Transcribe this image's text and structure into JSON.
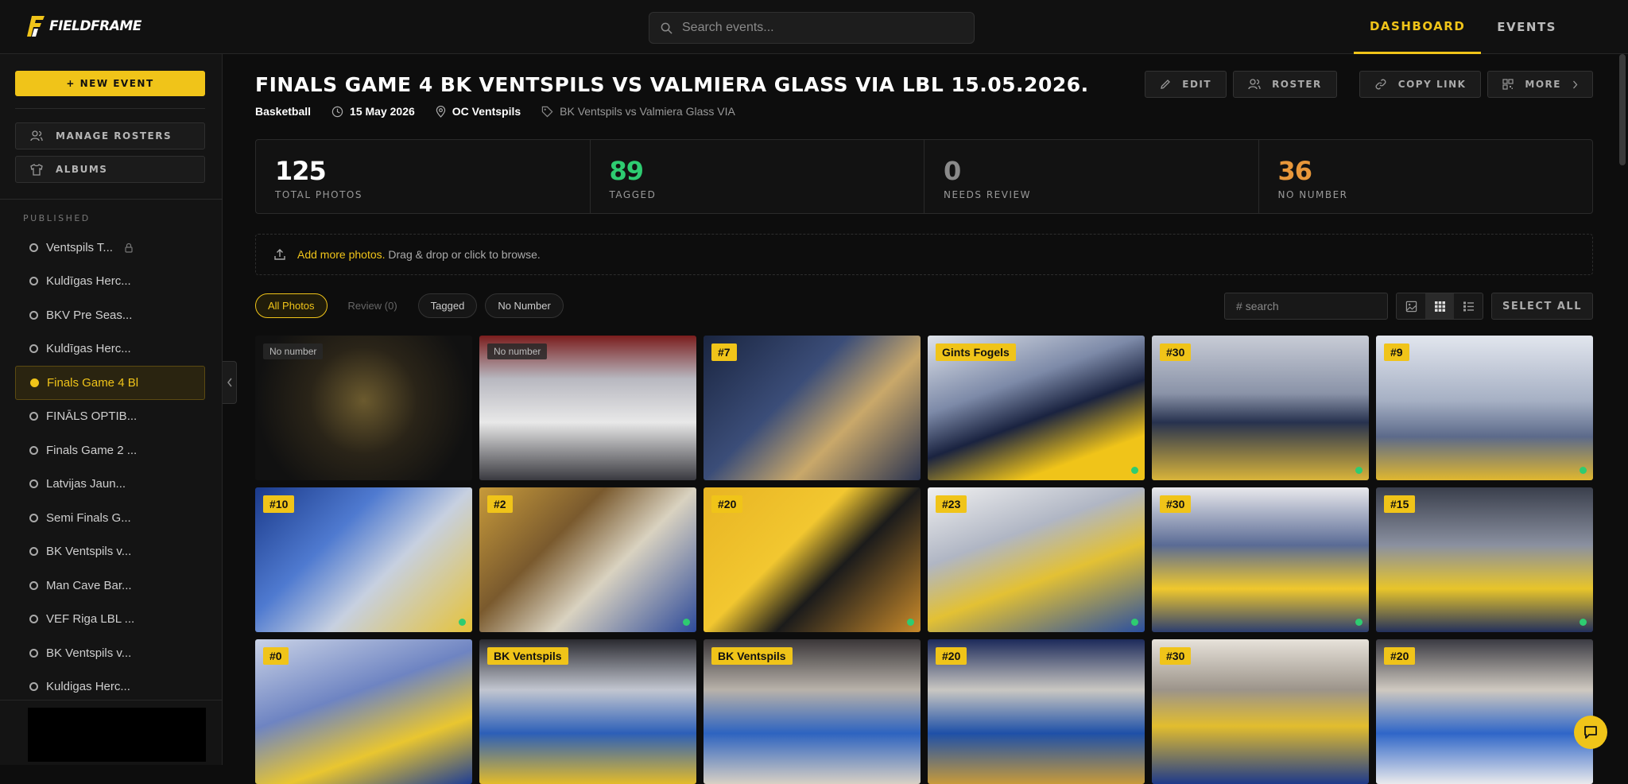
{
  "app": {
    "brand": "FIELDFRAME"
  },
  "topbar": {
    "search_placeholder": "Search events...",
    "nav": [
      {
        "label": "DASHBOARD",
        "active": true
      },
      {
        "label": "EVENTS",
        "active": false
      }
    ]
  },
  "sidebar": {
    "new_event_label": "+ NEW EVENT",
    "manage_rosters_label": "MANAGE ROSTERS",
    "albums_label": "ALBUMS",
    "section_label": "PUBLISHED",
    "events": [
      {
        "label": "Ventspils T...",
        "locked": true,
        "active": false
      },
      {
        "label": "Kuldīgas Herc...",
        "active": false
      },
      {
        "label": "BKV Pre Seas...",
        "active": false
      },
      {
        "label": "Kuldīgas Herc...",
        "active": false
      },
      {
        "label": "Finals Game 4 Bl",
        "active": true
      },
      {
        "label": "FINĀLS OPTIB...",
        "active": false
      },
      {
        "label": "Finals Game 2 ...",
        "active": false
      },
      {
        "label": "Latvijas Jaun...",
        "active": false
      },
      {
        "label": "Semi Finals G...",
        "active": false
      },
      {
        "label": "BK Ventspils v...",
        "active": false
      },
      {
        "label": "Man Cave Bar...",
        "active": false
      },
      {
        "label": "VEF Riga LBL ...",
        "active": false
      },
      {
        "label": "BK Ventspils v...",
        "active": false
      },
      {
        "label": "Kuldigas Herc...",
        "active": false
      }
    ]
  },
  "event": {
    "title": "FINALS GAME 4 BK VENTSPILS VS VALMIERA GLASS VIA LBL 15.05.2026.",
    "sport": "Basketball",
    "date": "15 May 2026",
    "venue": "OC Ventspils",
    "tag": "BK Ventspils vs Valmiera Glass VIA"
  },
  "actions": {
    "edit": "EDIT",
    "roster": "ROSTER",
    "copy_link": "COPY LINK",
    "more": "MORE"
  },
  "stats": [
    {
      "value": "125",
      "label": "TOTAL PHOTOS",
      "color": "#ffffff"
    },
    {
      "value": "89",
      "label": "TAGGED",
      "color": "#2ecc71"
    },
    {
      "value": "0",
      "label": "NEEDS REVIEW",
      "color": "#8a8a8a"
    },
    {
      "value": "36",
      "label": "NO NUMBER",
      "color": "#e8973a"
    }
  ],
  "upload": {
    "link": "Add more photos.",
    "text": "Drag & drop or click to browse."
  },
  "filters": [
    {
      "label": "All Photos",
      "state": "active"
    },
    {
      "label": "Review (0)",
      "state": "muted"
    },
    {
      "label": "Tagged",
      "state": "normal"
    },
    {
      "label": "No Number",
      "state": "normal"
    }
  ],
  "tools": {
    "number_search_placeholder": "# search",
    "select_all": "SELECT ALL"
  },
  "colors": {
    "accent": "#f0c419",
    "success": "#2ecc71",
    "warning": "#e8973a"
  },
  "photos": [
    {
      "tag": "No number",
      "style": "dark",
      "status": "none"
    },
    {
      "tag": "No number",
      "style": "dark",
      "status": "none"
    },
    {
      "tag": "#7",
      "style": "yellow",
      "status": "none"
    },
    {
      "tag": "Gints Fogels",
      "style": "yellow",
      "status": "ok"
    },
    {
      "tag": "#30",
      "style": "yellow",
      "status": "ok"
    },
    {
      "tag": "#9",
      "style": "yellow",
      "status": "ok"
    },
    {
      "tag": "#10",
      "style": "yellow",
      "status": "ok"
    },
    {
      "tag": "#2",
      "style": "yellow",
      "status": "ok"
    },
    {
      "tag": "#20",
      "style": "yellow",
      "status": "ok"
    },
    {
      "tag": "#23",
      "style": "yellow",
      "status": "ok"
    },
    {
      "tag": "#30",
      "style": "yellow",
      "status": "ok"
    },
    {
      "tag": "#15",
      "style": "yellow",
      "status": "ok"
    },
    {
      "tag": "#0",
      "style": "yellow",
      "status": "none"
    },
    {
      "tag": "BK Ventspils",
      "style": "yellow",
      "status": "none"
    },
    {
      "tag": "BK Ventspils",
      "style": "yellow",
      "status": "none"
    },
    {
      "tag": "#20",
      "style": "yellow",
      "status": "none"
    },
    {
      "tag": "#30",
      "style": "yellow",
      "status": "none"
    },
    {
      "tag": "#20",
      "style": "yellow",
      "status": "none"
    }
  ]
}
